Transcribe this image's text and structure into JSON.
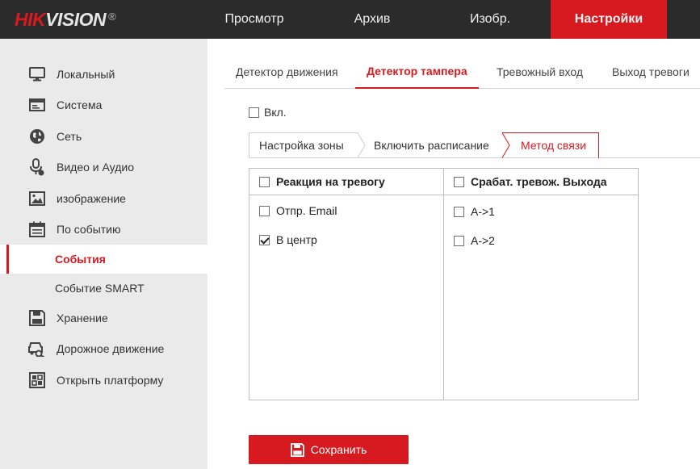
{
  "brand": {
    "logo_red": "HIK",
    "logo_light": "VISION",
    "logo_reg": "®"
  },
  "topnav": [
    {
      "label": "Просмотр",
      "active": false
    },
    {
      "label": "Архив",
      "active": false
    },
    {
      "label": "Изобр.",
      "active": false
    },
    {
      "label": "Настройки",
      "active": true
    }
  ],
  "sidebar": {
    "items": [
      {
        "label": "Локальный",
        "icon": "monitor-icon"
      },
      {
        "label": "Система",
        "icon": "system-window-icon"
      },
      {
        "label": "Сеть",
        "icon": "globe-icon"
      },
      {
        "label": "Видео и Аудио",
        "icon": "microphone-icon"
      },
      {
        "label": "изображение",
        "icon": "image-icon"
      },
      {
        "label": "По событию",
        "icon": "calendar-icon"
      },
      {
        "label": "События",
        "active": true
      },
      {
        "label": "Событие SMART"
      },
      {
        "label": "Хранение",
        "icon": "floppy-disk-icon"
      },
      {
        "label": "Дорожное движение",
        "icon": "vehicle-search-icon"
      },
      {
        "label": "Открыть платформу",
        "icon": "grid-platform-icon"
      }
    ]
  },
  "tabs": [
    {
      "label": "Детектор движения",
      "active": false
    },
    {
      "label": "Детектор тампера",
      "active": true
    },
    {
      "label": "Тревожный вход",
      "active": false
    },
    {
      "label": "Выход тревоги",
      "active": false
    }
  ],
  "enable": {
    "label": "Вкл.",
    "checked": false
  },
  "subtabs": [
    {
      "label": "Настройка зоны",
      "active": false
    },
    {
      "label": "Включить расписание",
      "active": false
    },
    {
      "label": "Метод связи",
      "active": true
    }
  ],
  "linkage": {
    "left": {
      "header": "Реакция на тревогу",
      "rows": [
        {
          "label": "Отпр. Email",
          "checked": false
        },
        {
          "label": "В центр",
          "checked": true
        }
      ]
    },
    "right": {
      "header": "Срабат. тревож. Выхода",
      "rows": [
        {
          "label": "A->1",
          "checked": false
        },
        {
          "label": "A->2",
          "checked": false
        }
      ]
    }
  },
  "save_button": {
    "label": "Сохранить",
    "icon": "floppy-disk-icon"
  },
  "colors": {
    "accent": "#d71920",
    "topbar": "#2b2b2b",
    "sidebar": "#eaeaea"
  }
}
